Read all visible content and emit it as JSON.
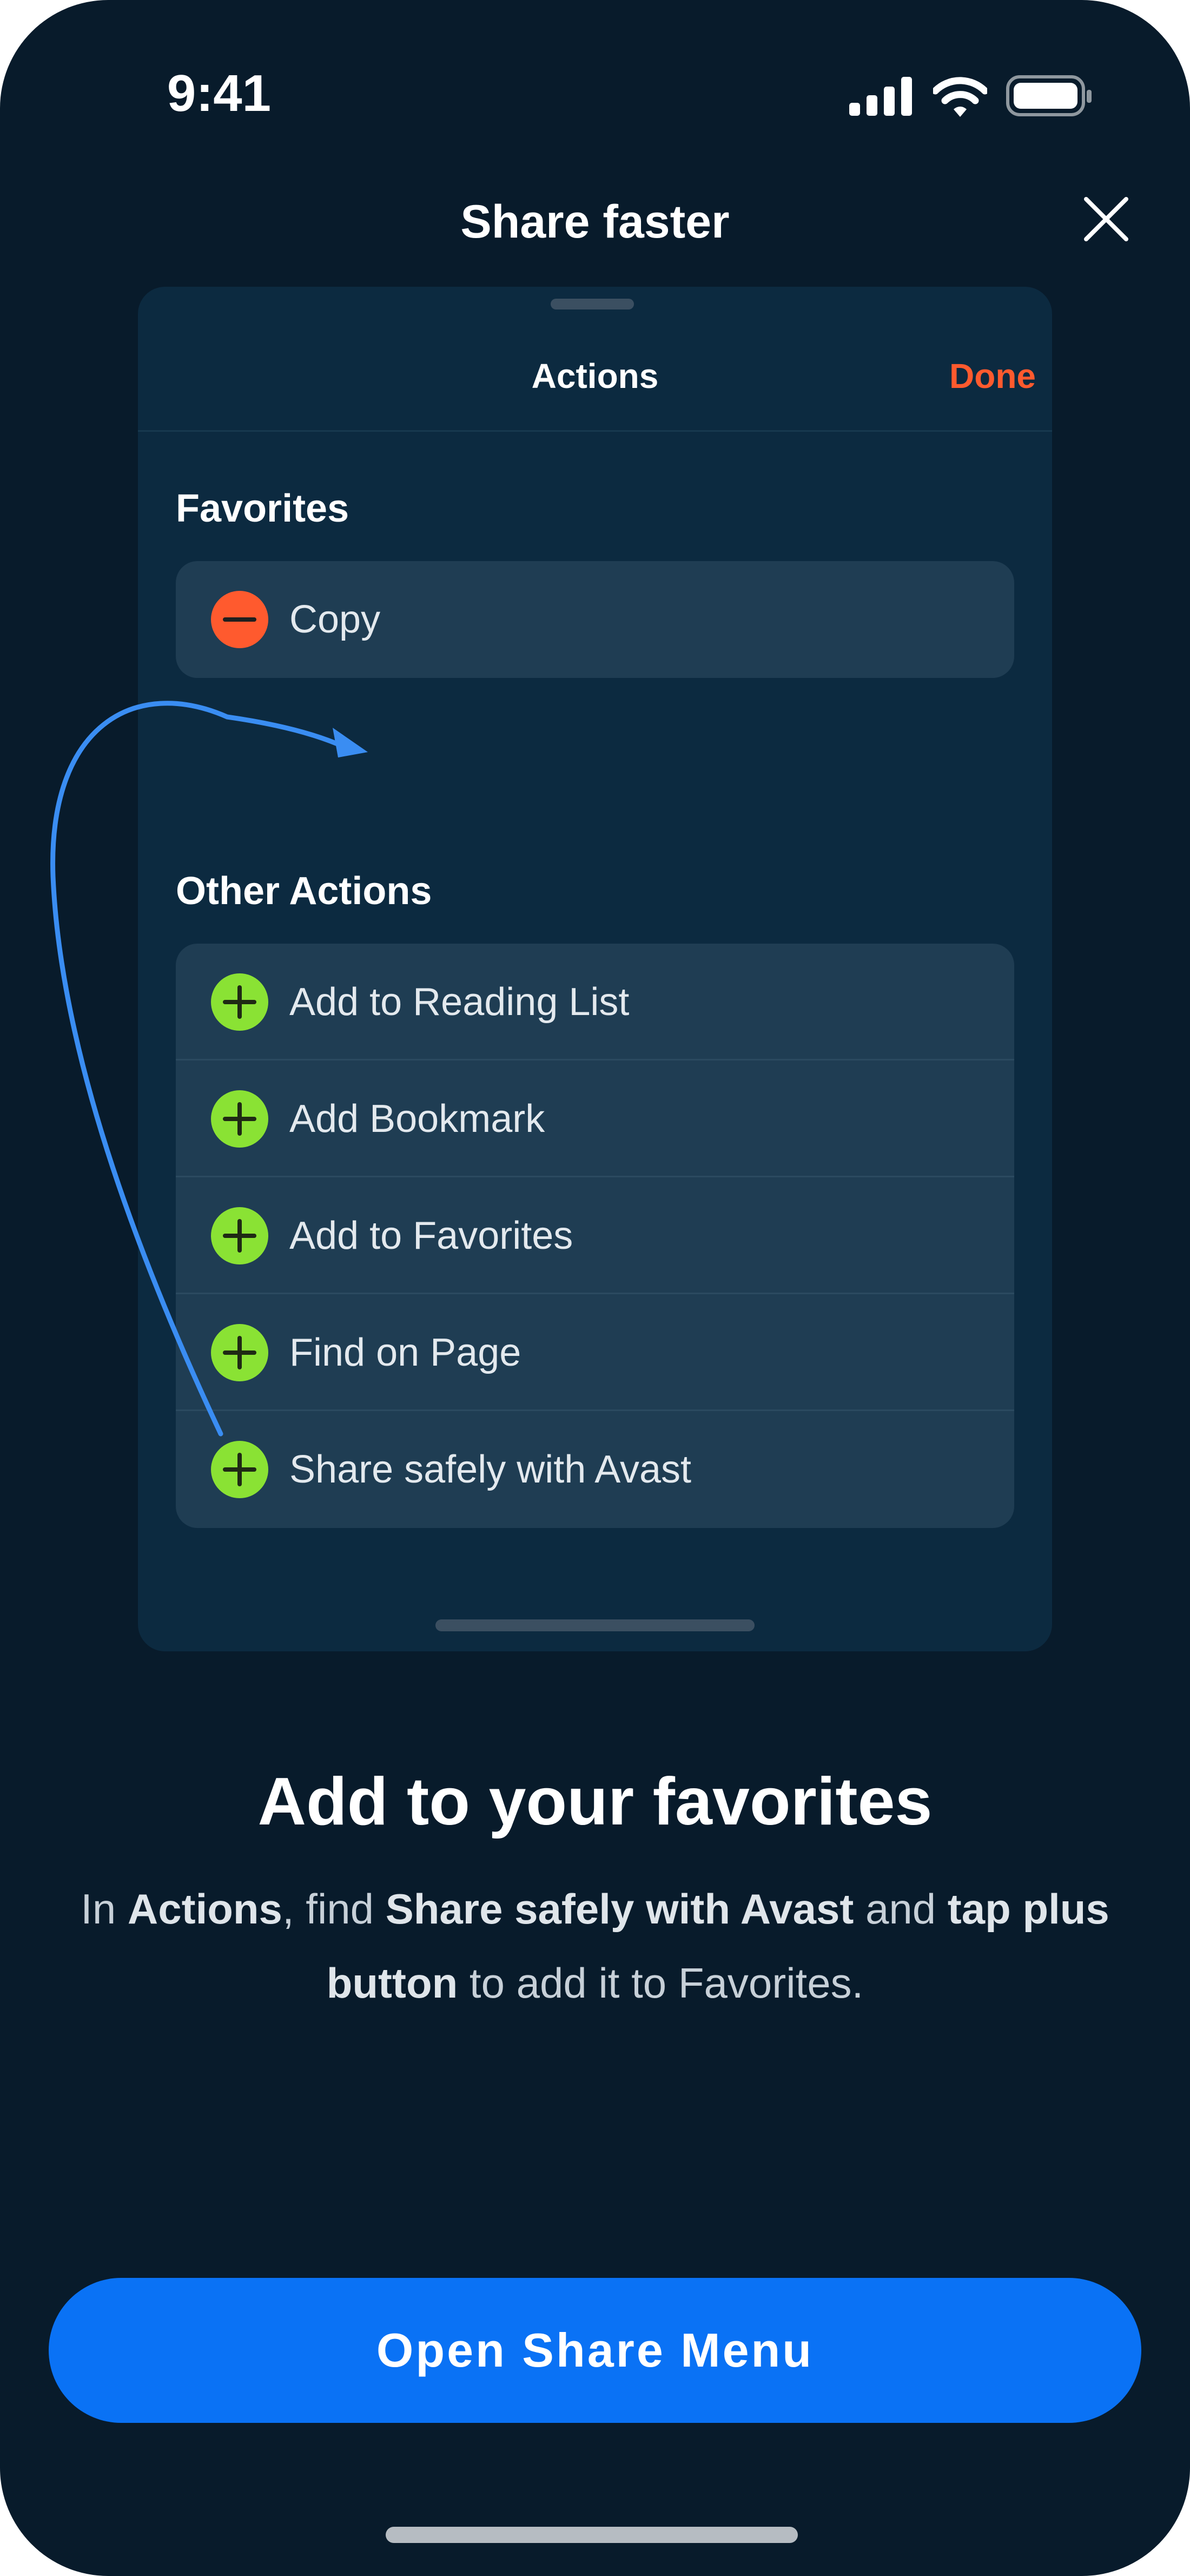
{
  "status_bar": {
    "time": "9:41"
  },
  "header": {
    "title": "Share faster"
  },
  "sheet": {
    "title": "Actions",
    "done_label": "Done",
    "favorites": {
      "title": "Favorites",
      "items": [
        {
          "label": "Copy",
          "icon": "minus-circle-icon"
        }
      ]
    },
    "other_actions": {
      "title": "Other Actions",
      "items": [
        {
          "label": "Add to Reading List",
          "icon": "plus-circle-icon"
        },
        {
          "label": "Add Bookmark",
          "icon": "plus-circle-icon"
        },
        {
          "label": "Add to Favorites",
          "icon": "plus-circle-icon"
        },
        {
          "label": "Find on Page",
          "icon": "plus-circle-icon"
        },
        {
          "label": "Share safely with Avast",
          "icon": "plus-circle-icon"
        }
      ]
    }
  },
  "main": {
    "heading": "Add to your favorites",
    "desc": {
      "p1": "In ",
      "b1": "Actions",
      "p2": ", find ",
      "b2": "Share safely with Avast",
      "p3": " and ",
      "b3": "tap plus button",
      "p4": " to add it to Favorites."
    }
  },
  "cta": {
    "label": "Open Share Menu"
  },
  "colors": {
    "background": "#081b2b",
    "card": "#0c2a40",
    "row": "#1f3d53",
    "accent_orange": "#ff5a2e",
    "plus_green": "#8ae234",
    "arrow_blue": "#3a8df2",
    "primary_button": "#0a72f5"
  }
}
